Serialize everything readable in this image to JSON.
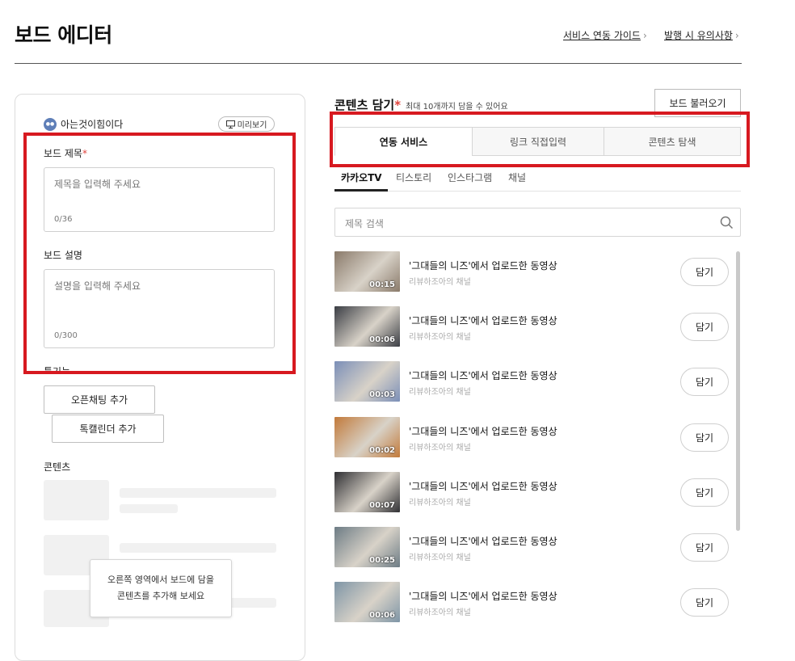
{
  "header": {
    "title": "보드 에디터",
    "links": [
      {
        "label": "서비스 연동 가이드"
      },
      {
        "label": "발행 시 유의사항"
      }
    ]
  },
  "editor": {
    "profile_name": "아는것이힘이다",
    "preview_label": "미리보기",
    "board_title_label": "보드 제목",
    "required_mark": "*",
    "title_placeholder": "제목을 입력해 주세요",
    "title_count": "0/36",
    "board_desc_label": "보드 설명",
    "desc_placeholder": "설명을 입력해 주세요",
    "desc_count": "0/300",
    "tools_label": "툴기능",
    "open_chat_button": "오픈채팅 추가",
    "talk_calendar_button": "톡캘린더 추가",
    "contents_label": "콘텐츠",
    "hint_line1": "오른쪽 영역에서 보드에 담을",
    "hint_line2": "콘텐츠를 추가해 보세요"
  },
  "contents": {
    "title": "콘텐츠 담기",
    "subtitle": "최대 10개까지 담을 수 있어요",
    "load_button": "보드 불러오기",
    "segments": [
      "연동 서비스",
      "링크 직접입력",
      "콘텐츠 탐색"
    ],
    "active_segment": "연동 서비스",
    "subtabs": [
      "카카오TV",
      "티스토리",
      "인스타그램",
      "채널"
    ],
    "search_placeholder": "제목 검색",
    "items": [
      {
        "title": "'그대들의 니즈'에서 업로드한 동영상",
        "channel": "리뷰하조아의 채널",
        "duration": "00:15",
        "add": "담기",
        "thumb_color": "#8a7a6a"
      },
      {
        "title": "'그대들의 니즈'에서 업로드한 동영상",
        "channel": "리뷰하조아의 채널",
        "duration": "00:06",
        "add": "담기",
        "thumb_color": "#3a3d44"
      },
      {
        "title": "'그대들의 니즈'에서 업로드한 동영상",
        "channel": "리뷰하조아의 채널",
        "duration": "00:03",
        "add": "담기",
        "thumb_color": "#7b8fb8"
      },
      {
        "title": "'그대들의 니즈'에서 업로드한 동영상",
        "channel": "리뷰하조아의 채널",
        "duration": "00:02",
        "add": "담기",
        "thumb_color": "#c27a3a"
      },
      {
        "title": "'그대들의 니즈'에서 업로드한 동영상",
        "channel": "리뷰하조아의 채널",
        "duration": "00:07",
        "add": "담기",
        "thumb_color": "#2f2f33"
      },
      {
        "title": "'그대들의 니즈'에서 업로드한 동영상",
        "channel": "리뷰하조아의 채널",
        "duration": "00:25",
        "add": "담기",
        "thumb_color": "#6d7c85"
      },
      {
        "title": "'그대들의 니즈'에서 업로드한 동영상",
        "channel": "리뷰하조아의 채널",
        "duration": "00:06",
        "add": "담기",
        "thumb_color": "#7e95a6"
      }
    ]
  },
  "colors": {
    "highlight_red": "#d71920",
    "required_red": "#e0433c",
    "avatar_blue": "#5f7fb8"
  }
}
